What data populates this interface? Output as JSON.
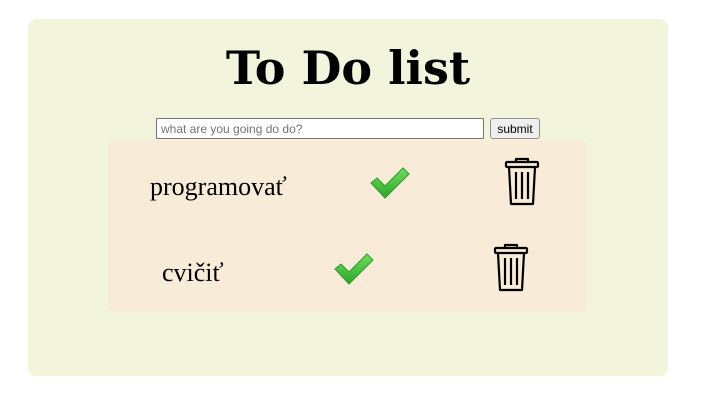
{
  "app": {
    "title": "To Do list"
  },
  "form": {
    "input_value": "",
    "input_placeholder": "what are you going do do?",
    "submit_label": "submit"
  },
  "tasks": [
    {
      "name": "programovať",
      "complete_icon": "checkmark-icon",
      "delete_icon": "trash-icon"
    },
    {
      "name": "cvičiť",
      "complete_icon": "checkmark-icon",
      "delete_icon": "trash-icon"
    }
  ],
  "colors": {
    "app_background": "#f2f4dc",
    "list_background": "#f8ebd8",
    "check_green": "#3cc43a"
  }
}
